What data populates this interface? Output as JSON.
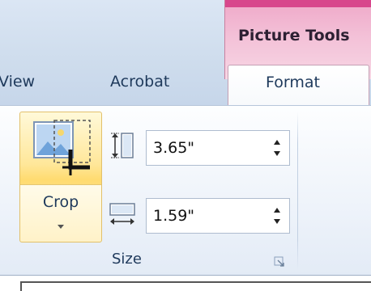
{
  "ribbon": {
    "contextual_group": {
      "title": "Picture Tools",
      "color": "#d8468c"
    },
    "tabs": [
      {
        "label": "View",
        "visible_text": "View",
        "active": false
      },
      {
        "label": "Acrobat",
        "active": false
      },
      {
        "label": "Format",
        "active": true
      }
    ],
    "crop": {
      "label": "Crop",
      "icon": "crop-icon",
      "dropdown_icon": "chevron-down-icon"
    },
    "size_group": {
      "label": "Size",
      "height": {
        "icon": "shape-height-icon",
        "value": "3.65\""
      },
      "width": {
        "icon": "shape-width-icon",
        "value": "1.59\""
      },
      "launcher_icon": "dialog-launcher-icon"
    }
  },
  "colors": {
    "tab_text": "#1e395b",
    "highlight": "#ffdb70",
    "contextual_pink": "#f3c0d7"
  }
}
